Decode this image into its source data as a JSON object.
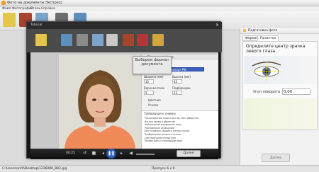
{
  "window": {
    "title": "Фото на документы Экспресс"
  },
  "menu": [
    "Файл",
    "Фотография",
    "Стиль",
    "Справка"
  ],
  "right_panel": {
    "header": "Подготовка фото",
    "tabs": [
      "Формат",
      "Разметка"
    ],
    "heading": "Определите центр зрачка левого глаза",
    "angle_label": "Угол поворота",
    "angle_value": "0.00",
    "next_button": "Далее"
  },
  "video": {
    "title": "Tutorial",
    "time": "00:25",
    "inner_panel_header": "Подготовка фото",
    "inner_tabs": [
      "Формат",
      "Разметка"
    ],
    "format_value": "Паспорт РФ",
    "width_label": "Ширина (мм)",
    "height_label": "Высота (мм)",
    "width_value": "35",
    "height_value": "45",
    "top_margin_label": "Верхнее поле",
    "chin_label": "Подбородок",
    "top_margin_value": "5",
    "chin_value": "13",
    "color_label": "Цветное",
    "corners_label": "Уголок",
    "requirements_header": "Требования к снимку",
    "requirements": [
      "Расположение лица в центре, без поворотов",
      "Взгляд прямо в объектив",
      "Нейтральное выражение лица",
      "Равномерное освещение",
      "Без головных уборов и тёмных очков",
      "Изображение резкое и чёткое",
      "Светлый однотонный фон",
      "Размер фото и пропорции лица"
    ],
    "next_button": "Далее"
  },
  "callout": {
    "text": "Выберем формат документа"
  },
  "statusbar": {
    "path": "C:\\Users\\anf4\\Desktop\\1236080_882.jpg",
    "info": "Пропуск 6 х 9"
  }
}
